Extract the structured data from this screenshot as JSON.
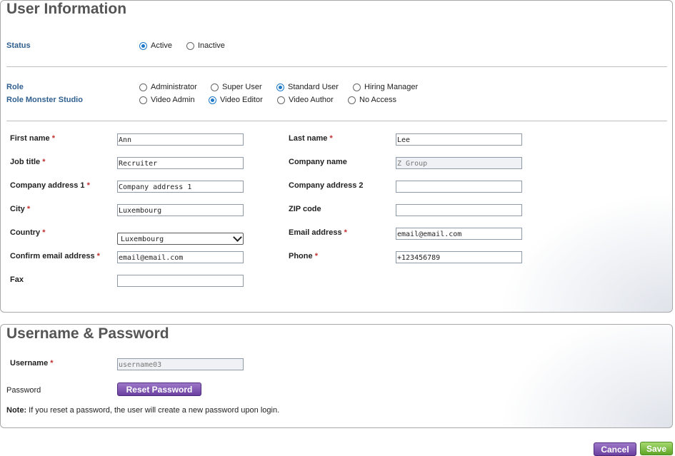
{
  "user_info": {
    "title": "User Information",
    "status": {
      "label": "Status",
      "options": [
        {
          "label": "Active",
          "selected": true
        },
        {
          "label": "Inactive",
          "selected": false
        }
      ]
    },
    "role": {
      "label": "Role",
      "options": [
        {
          "label": "Administrator",
          "selected": false
        },
        {
          "label": "Super User",
          "selected": false
        },
        {
          "label": "Standard User",
          "selected": true
        },
        {
          "label": "Hiring Manager",
          "selected": false
        }
      ]
    },
    "role_monster_studio": {
      "label": "Role Monster Studio",
      "options": [
        {
          "label": "Video Admin",
          "selected": false
        },
        {
          "label": "Video Editor",
          "selected": true
        },
        {
          "label": "Video Author",
          "selected": false
        },
        {
          "label": "No Access",
          "selected": false
        }
      ]
    },
    "fields": {
      "first_name": {
        "label": "First name",
        "required": "*",
        "value": "Ann"
      },
      "last_name": {
        "label": "Last name",
        "required": "*",
        "value": "Lee"
      },
      "job_title": {
        "label": "Job title",
        "required": "*",
        "value": "Recruiter"
      },
      "company_name": {
        "label": "Company name",
        "value": "Z Group"
      },
      "company_address_1": {
        "label": "Company address 1",
        "required": "*",
        "value": "Company address 1"
      },
      "company_address_2": {
        "label": "Company address 2",
        "value": ""
      },
      "city": {
        "label": "City",
        "required": "*",
        "value": "Luxembourg"
      },
      "zip_code": {
        "label": "ZIP code",
        "value": ""
      },
      "country": {
        "label": "Country",
        "required": "*",
        "value": "Luxembourg"
      },
      "email": {
        "label": "Email address",
        "required": "*",
        "value": "email@email.com"
      },
      "confirm_email": {
        "label": "Confirm email address",
        "required": "*",
        "value": "email@email.com"
      },
      "phone": {
        "label": "Phone",
        "required": "*",
        "value": "+123456789"
      },
      "fax": {
        "label": "Fax",
        "value": ""
      }
    }
  },
  "credentials": {
    "title": "Username & Password",
    "username": {
      "label": "Username",
      "required": "*",
      "value": "username03"
    },
    "password": {
      "label": "Password",
      "reset_button": "Reset Password"
    },
    "note_bold": "Note:",
    "note_text": " If you reset a password, the user will create a new password upon login."
  },
  "actions": {
    "cancel": "Cancel",
    "save": "Save"
  },
  "colors": {
    "accent_label": "#2f5f8f",
    "radio_selected": "#1e78c8",
    "required": "#c03030",
    "cancel_button": "#6b3fa0",
    "save_button": "#5fa628"
  },
  "icons": {
    "country_dropdown": "chevron-down-icon"
  }
}
